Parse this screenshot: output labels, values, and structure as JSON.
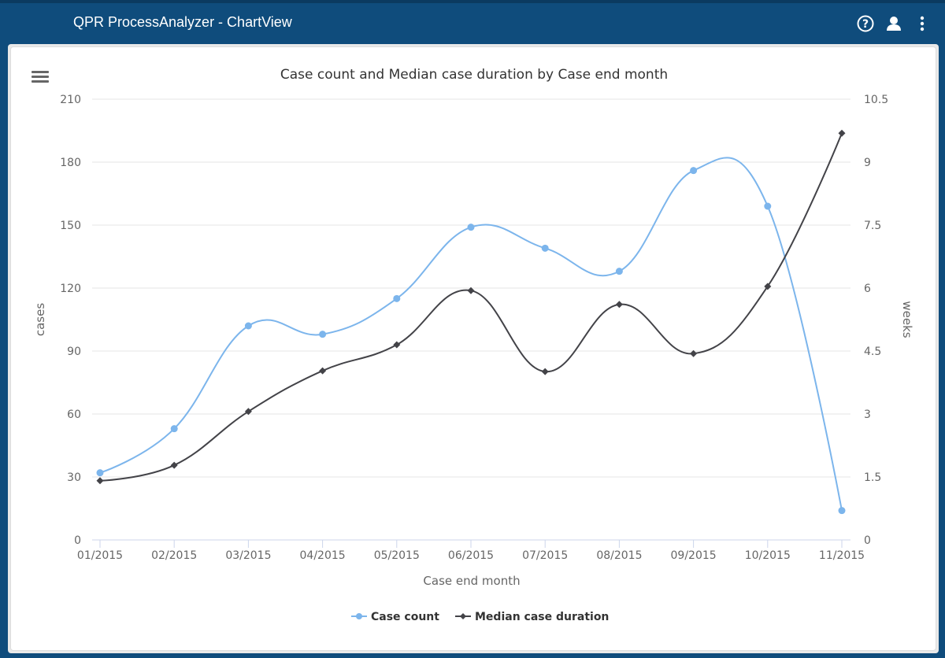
{
  "app": {
    "title": "QPR ProcessAnalyzer - ChartView",
    "icons": [
      "help-icon",
      "user-icon",
      "more-vertical-icon"
    ]
  },
  "chart_menu_icon": "hamburger-menu-icon",
  "chart_data": {
    "type": "line",
    "title": "Case count and Median case duration by Case end month",
    "xlabel": "Case end month",
    "categories": [
      "01/2015",
      "02/2015",
      "03/2015",
      "04/2015",
      "05/2015",
      "06/2015",
      "07/2015",
      "08/2015",
      "09/2015",
      "10/2015",
      "11/2015"
    ],
    "y_axes": [
      {
        "label": "cases",
        "position": "left",
        "range": [
          0,
          210
        ],
        "ticks": [
          "0",
          "30",
          "60",
          "90",
          "120",
          "150",
          "180",
          "210"
        ]
      },
      {
        "label": "weeks",
        "position": "right",
        "range": [
          0,
          10.5
        ],
        "ticks": [
          "0",
          "1.5",
          "3",
          "4.5",
          "6",
          "7.5",
          "9",
          "10.5"
        ]
      }
    ],
    "series": [
      {
        "name": "Case count",
        "axis": 0,
        "color": "#7cb5ec",
        "marker": "circle",
        "smooth": true,
        "values": [
          32,
          53,
          102,
          98,
          115,
          149,
          139,
          128,
          176,
          159,
          14
        ]
      },
      {
        "name": "Median case duration",
        "axis": 1,
        "color": "#434348",
        "marker": "diamond",
        "smooth": true,
        "values": [
          1.41,
          1.78,
          3.06,
          4.03,
          4.65,
          5.94,
          4.01,
          5.61,
          4.44,
          6.04,
          9.69
        ]
      }
    ],
    "grid": true,
    "legend": "bottom-center"
  }
}
